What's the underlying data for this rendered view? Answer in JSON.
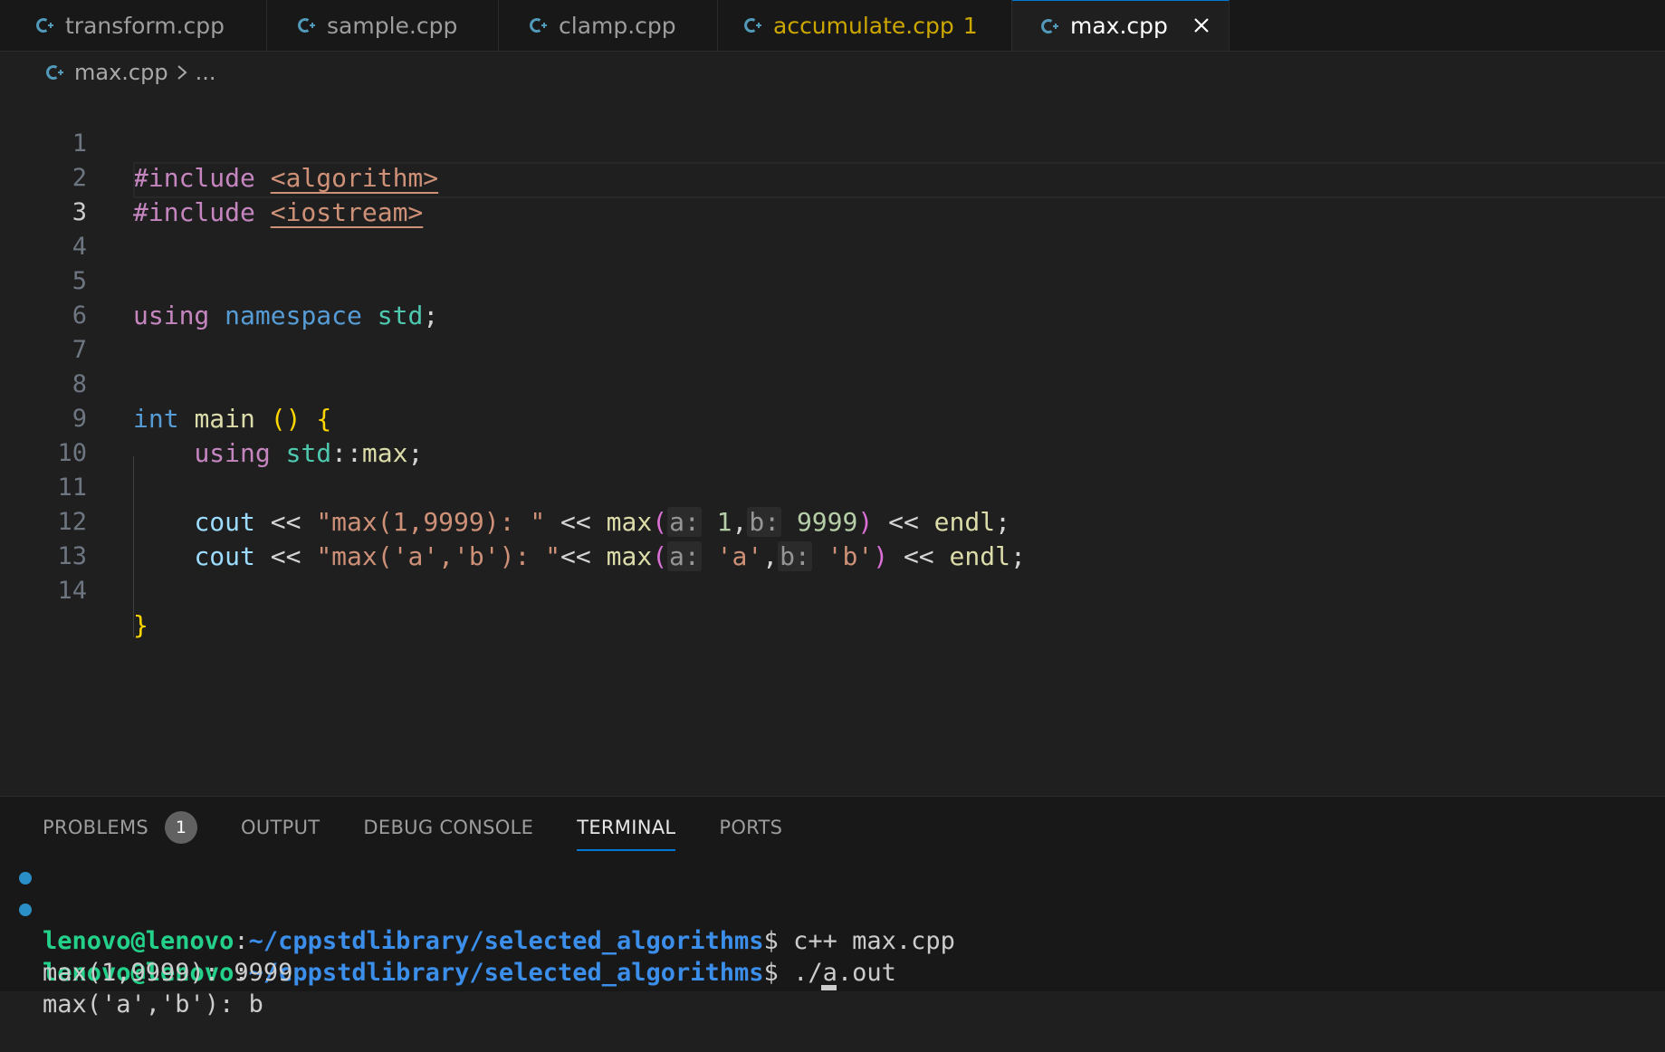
{
  "tabs": [
    {
      "name": "transform.cpp",
      "active": false,
      "problems": ""
    },
    {
      "name": "sample.cpp",
      "active": false,
      "problems": ""
    },
    {
      "name": "clamp.cpp",
      "active": false,
      "problems": ""
    },
    {
      "name": "accumulate.cpp",
      "active": false,
      "problems": "1"
    },
    {
      "name": "max.cpp",
      "active": true,
      "problems": ""
    }
  ],
  "breadcrumb": {
    "file": "max.cpp",
    "more": "..."
  },
  "editor": {
    "current_line": 3,
    "line_numbers": [
      "1",
      "2",
      "3",
      "4",
      "5",
      "6",
      "7",
      "8",
      "9",
      "10",
      "11",
      "12",
      "13",
      "14"
    ],
    "lines": {
      "l1": {
        "directive": "#include",
        "header": "<algorithm>"
      },
      "l2": {
        "directive": "#include",
        "header": "<iostream>"
      },
      "l5": {
        "kw_using": "using",
        "kw_namespace": "namespace",
        "ns": "std",
        "semi": ";"
      },
      "l8": {
        "type": "int",
        "fn": "main",
        "parens": "()",
        "brace": "{"
      },
      "l9": {
        "kw_using": "using",
        "ns": "std",
        "scope": "::",
        "name": "max",
        "semi": ";"
      },
      "l11": {
        "cout": "cout",
        "op1": "<<",
        "str": "\"max(1,9999): \"",
        "op2": "<<",
        "fn": "max",
        "lp": "(",
        "hint_a": "a:",
        "arg_a": "1",
        "comma": ",",
        "hint_b": "b:",
        "arg_b": "9999",
        "rp": ")",
        "op3": "<<",
        "endl": "endl",
        "semi": ";"
      },
      "l12": {
        "cout": "cout",
        "op1": "<<",
        "str": "\"max('a','b'): \"",
        "op2": "<<",
        "fn": "max",
        "lp": "(",
        "hint_a": "a:",
        "arg_a": "'a'",
        "comma": ",",
        "hint_b": "b:",
        "arg_b": "'b'",
        "rp": ")",
        "op3": "<<",
        "endl": "endl",
        "semi": ";"
      },
      "l14": {
        "brace": "}"
      }
    }
  },
  "panel": {
    "tabs": [
      {
        "label": "PROBLEMS",
        "count": "1",
        "active": false
      },
      {
        "label": "OUTPUT",
        "active": false
      },
      {
        "label": "DEBUG CONSOLE",
        "active": false
      },
      {
        "label": "TERMINAL",
        "active": true
      },
      {
        "label": "PORTS",
        "active": false
      }
    ]
  },
  "terminal": {
    "user": "lenovo@lenovo",
    "colon": ":",
    "path": "~/cppstdlibrary/selected_algorithms",
    "prompt": "$",
    "cmd1": " c++ max.cpp",
    "cmd2": " ./a.out",
    "out1": "max(1,9999): 9999",
    "out2": "max('a','b'): b"
  },
  "colors": {
    "accent": "#0078d4",
    "warning": "#cca700",
    "terminal_user": "#23d18b",
    "terminal_path": "#3b8eea",
    "cpp_icon": "#519aba"
  }
}
